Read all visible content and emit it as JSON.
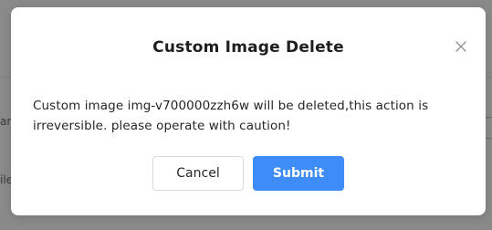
{
  "dialog": {
    "title": "Custom Image Delete",
    "message": "Custom image img-v700000zzh6w will be deleted,this action is irreversible. please operate with caution!",
    "cancel_label": "Cancel",
    "submit_label": "Submit",
    "close_icon": "close-icon"
  },
  "background": {
    "left_edge_text_1": "ar",
    "left_edge_text_2": "ile"
  },
  "colors": {
    "primary": "#3d8cf7",
    "overlay": "#8a8a8a",
    "dialog_bg": "#ffffff",
    "text": "#262626"
  }
}
